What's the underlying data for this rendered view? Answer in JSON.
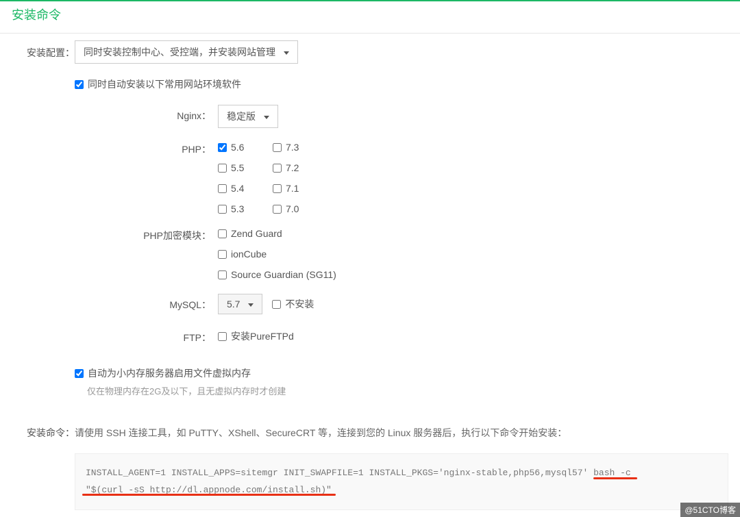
{
  "page": {
    "title": "安装命令"
  },
  "labels": {
    "config": "安装配置：",
    "command": "安装命令："
  },
  "config_select": {
    "value": "同时安装控制中心、受控端，并安装网站管理"
  },
  "auto_install_env": {
    "checked": true,
    "label": "同时自动安装以下常用网站环境软件"
  },
  "nginx": {
    "label": "Nginx：",
    "value": "稳定版"
  },
  "php": {
    "label": "PHP：",
    "options": [
      {
        "label": "5.6",
        "checked": true
      },
      {
        "label": "7.3",
        "checked": false
      },
      {
        "label": "5.5",
        "checked": false
      },
      {
        "label": "7.2",
        "checked": false
      },
      {
        "label": "5.4",
        "checked": false
      },
      {
        "label": "7.1",
        "checked": false
      },
      {
        "label": "5.3",
        "checked": false
      },
      {
        "label": "7.0",
        "checked": false
      }
    ]
  },
  "php_encrypt": {
    "label": "PHP加密模块：",
    "options": [
      {
        "label": "Zend Guard",
        "checked": false
      },
      {
        "label": "ionCube",
        "checked": false
      },
      {
        "label": "Source Guardian (SG11)",
        "checked": false
      }
    ]
  },
  "mysql": {
    "label": "MySQL：",
    "value": "5.7",
    "no_install_label": "不安装",
    "no_install_checked": false
  },
  "ftp": {
    "label": "FTP：",
    "option_label": "安装PureFTPd",
    "checked": false
  },
  "swap": {
    "checked": true,
    "label": "自动为小内存服务器启用文件虚拟内存",
    "hint": "仅在物理内存在2G及以下，且无虚拟内存时才创建"
  },
  "command": {
    "instruction": "请使用 SSH 连接工具，如 PuTTY、XShell、SecureCRT 等，连接到您的 Linux 服务器后，执行以下命令开始安装：",
    "code_line1": "INSTALL_AGENT=1 INSTALL_APPS=sitemgr INIT_SWAPFILE=1 INSTALL_PKGS='nginx-stable,php56,mysql57' bash -c",
    "code_line2": "\"$(curl -sS http://dl.appnode.com/install.sh)\""
  },
  "watermark": "@51CTO博客"
}
